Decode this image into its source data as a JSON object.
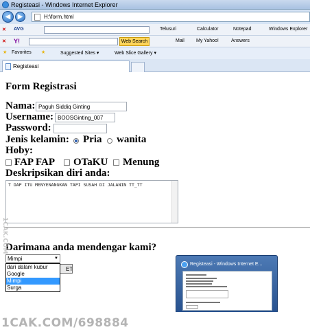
{
  "window": {
    "title": "Registeasi - Windows Internet Explorer"
  },
  "address": {
    "url": "H:\\form.html"
  },
  "avg_toolbar": {
    "brand": "AVG",
    "items": [
      "Telusuri",
      "Calculator",
      "Notepad",
      "Windows Explorer"
    ]
  },
  "yahoo_toolbar": {
    "brand": "Y!",
    "search_button": "Web Search",
    "items": [
      "Mail",
      "My Yahoo!",
      "Answers"
    ]
  },
  "favorites_bar": {
    "favorites": "Favorites",
    "suggested": "Suggested Sites ▾",
    "webslice": "Web Slice Gallery ▾"
  },
  "tab": {
    "title": "Registeasi"
  },
  "form": {
    "heading": "Form Registrasi",
    "nama_label": "Nama:",
    "nama_value": "Paguh Siddiq Ginting",
    "username_label": "Username:",
    "username_value": "BOOSGinting_007",
    "password_label": "Password:",
    "jenis_label": "Jenis kelamin:",
    "gender_options": [
      {
        "label": "Pria",
        "checked": true
      },
      {
        "label": "wanita",
        "checked": false
      }
    ],
    "hoby_label": "Hoby:",
    "hobby_options": [
      {
        "label": "FAP FAP"
      },
      {
        "label": "OTaKU"
      },
      {
        "label": "Menung"
      }
    ],
    "deskripsi_label": "Deskripsikan diri anda:",
    "deskripsi_value": "T DAP ITU MENYENANGKAN TAPI SUSAH DI JALANIN TT_TT",
    "source_question": "Darimana anda mendengar kami?",
    "source_selected": "Mimpi",
    "source_options": [
      "dari dalam kubur",
      "Google",
      "Mimpi",
      "Surga"
    ],
    "submit_label": "ET"
  },
  "taskbar_preview": {
    "title": "Registeasi - Windows Internet E..."
  },
  "watermark": {
    "text": "1CAK.COM/698884",
    "side_text": "1CAK.COM"
  }
}
